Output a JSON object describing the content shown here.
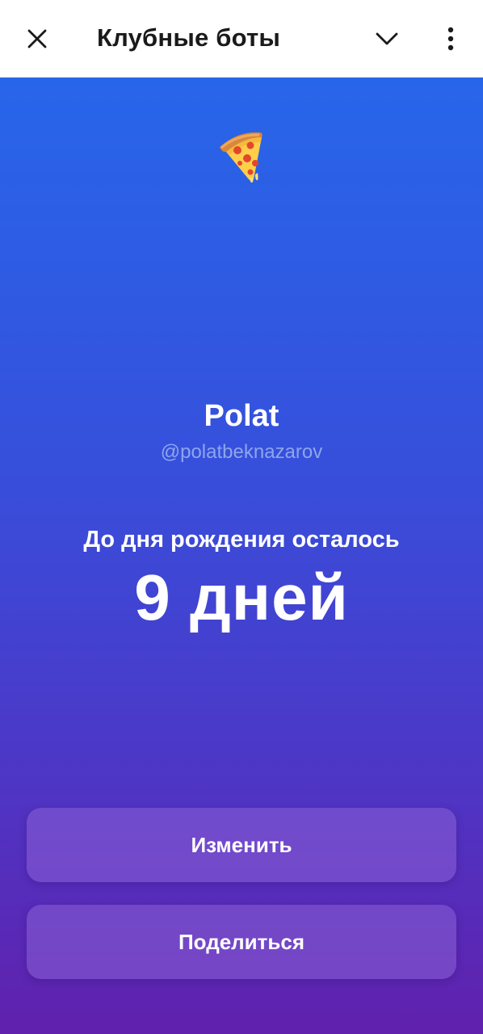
{
  "header": {
    "title": "Клубные боты",
    "close_icon": "close-icon",
    "chevron_icon": "chevron-down-icon",
    "more_icon": "more-vertical-icon"
  },
  "profile": {
    "icon": "pizza-icon",
    "name": "Polat",
    "handle": "@polatbeknazarov"
  },
  "countdown": {
    "label": "До дня рождения осталось",
    "value": "9 дней"
  },
  "actions": {
    "edit_label": "Изменить",
    "share_label": "Поделиться"
  },
  "colors": {
    "gradient_top": "#2766ea",
    "gradient_bottom": "#6021ad",
    "handle_text": "#8ea5ee"
  }
}
